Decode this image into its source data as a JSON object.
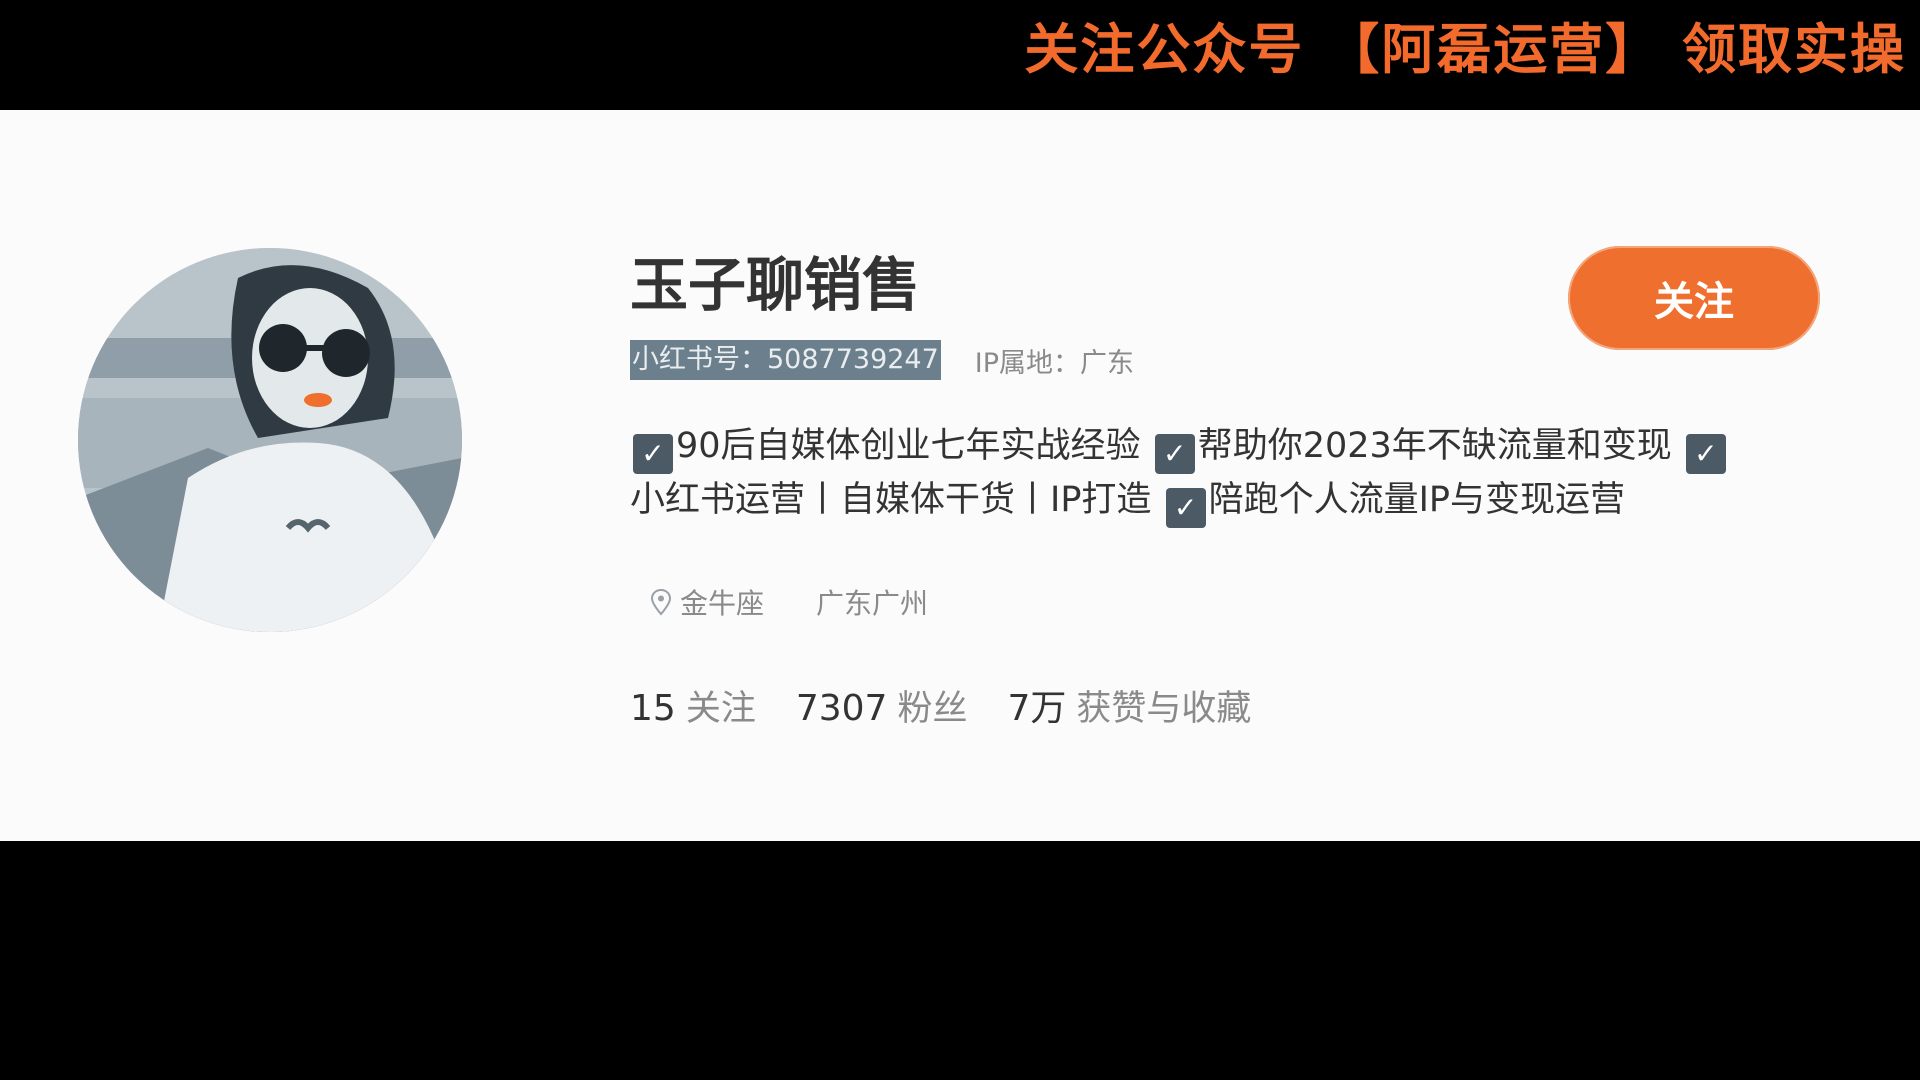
{
  "banner": {
    "text": "关注公众号 【阿磊运营】 领取实操",
    "color": "#f26b2d"
  },
  "profile": {
    "username": "玉子聊销售",
    "red_id": "小红书号：5087739247",
    "ip_location": "IP属地：广东",
    "bio": {
      "line1": [
        "90后自媒体创业七年实战经验",
        "帮助你2023年不缺流量和变现"
      ],
      "line2_lead": "小红书运营丨自媒体干货丨IP打造",
      "line2_tail": "陪跑个人流量IP与变现运营",
      "check_glyph": "✓"
    },
    "tags": {
      "zodiac": "金牛座",
      "region": "广东广州"
    },
    "stats": [
      {
        "value": "15",
        "label": "关注"
      },
      {
        "value": "7307",
        "label": "粉丝"
      },
      {
        "value": "7万",
        "label": "获赞与收藏"
      }
    ],
    "follow_button": "关注"
  },
  "colors": {
    "accent": "#ef6f2e",
    "text_primary": "#333333",
    "text_secondary": "#8a8a8a",
    "card_bg": "#fbfbfb",
    "id_highlight": "#6b7f8c"
  },
  "icons": {
    "location": "location-pin-icon",
    "check": "checkbox-checked-icon"
  }
}
